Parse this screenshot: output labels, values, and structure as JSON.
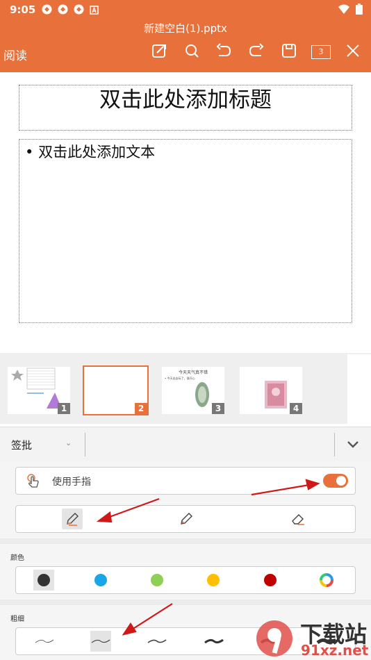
{
  "status_bar": {
    "time": "9:05",
    "icons": [
      "notification-icon",
      "notification-icon",
      "notification-icon",
      "a-icon"
    ],
    "right_icons": [
      "wifi-icon",
      "battery-icon"
    ]
  },
  "toolbar": {
    "doc_title": "新建空白(1).pptx",
    "read_label": "阅读",
    "page_count": "3",
    "buttons": [
      "edit-icon",
      "search-icon",
      "undo-icon",
      "redo-icon",
      "save-icon",
      "page-count-icon",
      "close-icon"
    ]
  },
  "slide": {
    "title_placeholder": "双击此处添加标题",
    "body_placeholder": "双击此处添加文本",
    "bullet": "•"
  },
  "thumbnails": {
    "items": [
      {
        "number": "1",
        "active": false
      },
      {
        "number": "2",
        "active": true
      },
      {
        "number": "3",
        "active": false,
        "caption": "今天天气真不错",
        "line": "• 今天出去玩了，很开心"
      },
      {
        "number": "4",
        "active": false
      }
    ]
  },
  "panel": {
    "mode_label": "签批",
    "use_finger_label": "使用手指",
    "use_finger_on": true,
    "color_label": "颜色",
    "colors": [
      "#333333",
      "#1aa5e6",
      "#8fcf55",
      "#ffbf00",
      "#c00000",
      "multicolor"
    ],
    "selected_color": 0,
    "width_label": "粗细",
    "selected_width": 1
  },
  "watermark": {
    "text_cn": "下载站",
    "text_url": "91xz.net"
  }
}
